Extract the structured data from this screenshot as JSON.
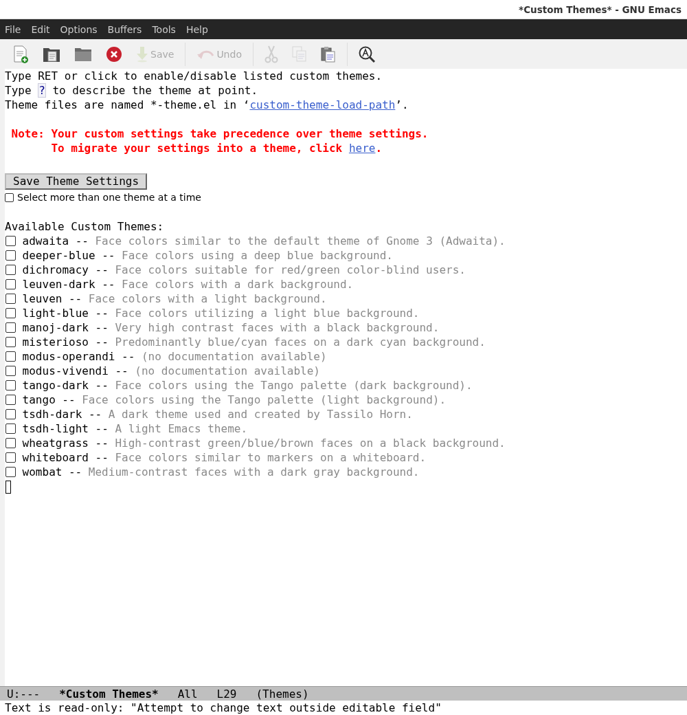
{
  "window": {
    "title": "*Custom Themes* - GNU Emacs"
  },
  "menu_bar": [
    "File",
    "Edit",
    "Options",
    "Buffers",
    "Tools",
    "Help"
  ],
  "toolbar": [
    {
      "kind": "new-file",
      "disabled": false
    },
    {
      "kind": "open-file",
      "disabled": false
    },
    {
      "kind": "open-dir",
      "disabled": false
    },
    {
      "kind": "close",
      "disabled": false
    },
    {
      "kind": "save",
      "label": "Save",
      "disabled": true
    },
    {
      "kind": "separator"
    },
    {
      "kind": "undo",
      "label": "Undo",
      "disabled": true
    },
    {
      "kind": "separator"
    },
    {
      "kind": "cut",
      "disabled": true
    },
    {
      "kind": "copy",
      "disabled": true
    },
    {
      "kind": "paste",
      "disabled": false
    },
    {
      "kind": "separator"
    },
    {
      "kind": "search",
      "disabled": false
    }
  ],
  "help_lines": [
    [
      {
        "kind": "text",
        "text": "Type RET or click to enable/disable listed custom themes."
      }
    ],
    [
      {
        "kind": "text",
        "text": "Type "
      },
      {
        "kind": "key",
        "text": "?"
      },
      {
        "kind": "text",
        "text": " to describe the theme at point."
      }
    ],
    [
      {
        "kind": "text",
        "text": "Theme files are named *-theme.el in ‘"
      },
      {
        "kind": "link",
        "text": "custom-theme-load-path"
      },
      {
        "kind": "text",
        "text": "’."
      }
    ]
  ],
  "note_lines": [
    [
      {
        "kind": "text",
        "text": "Note: Your custom settings take precedence over theme settings."
      }
    ],
    [
      {
        "kind": "text",
        "text": "      To migrate your settings into a theme, click "
      },
      {
        "kind": "link",
        "text": "here"
      },
      {
        "kind": "text",
        "text": "."
      }
    ]
  ],
  "save_button": "Save Theme Settings",
  "multi_select": {
    "label": "Select more than one theme at a time",
    "checked": false
  },
  "themes_heading": "Available Custom Themes:",
  "themes": [
    {
      "name": "adwaita",
      "separator": "--",
      "description": "Face colors similar to the default theme of Gnome 3 (Adwaita).",
      "checked": false
    },
    {
      "name": "deeper-blue",
      "separator": "--",
      "description": "Face colors using a deep blue background.",
      "checked": false
    },
    {
      "name": "dichromacy",
      "separator": "--",
      "description": "Face colors suitable for red/green color-blind users.",
      "checked": false
    },
    {
      "name": "leuven-dark",
      "separator": "--",
      "description": "Face colors with a dark background.",
      "checked": false
    },
    {
      "name": "leuven",
      "separator": "--",
      "description": "Face colors with a light background.",
      "checked": false
    },
    {
      "name": "light-blue",
      "separator": "--",
      "description": "Face colors utilizing a light blue background.",
      "checked": false
    },
    {
      "name": "manoj-dark",
      "separator": "--",
      "description": "Very high contrast faces with a black background.",
      "checked": false
    },
    {
      "name": "misterioso",
      "separator": "--",
      "description": "Predominantly blue/cyan faces on a dark cyan background.",
      "checked": false
    },
    {
      "name": "modus-operandi",
      "separator": "--",
      "description": "(no documentation available)",
      "checked": false
    },
    {
      "name": "modus-vivendi",
      "separator": "--",
      "description": "(no documentation available)",
      "checked": false
    },
    {
      "name": "tango-dark",
      "separator": "--",
      "description": "Face colors using the Tango palette (dark background).",
      "checked": false
    },
    {
      "name": "tango",
      "separator": "--",
      "description": "Face colors using the Tango palette (light background).",
      "checked": false
    },
    {
      "name": "tsdh-dark",
      "separator": "--",
      "description": "A dark theme used and created by Tassilo Horn.",
      "checked": false
    },
    {
      "name": "tsdh-light",
      "separator": "--",
      "description": "A light Emacs theme.",
      "checked": false
    },
    {
      "name": "wheatgrass",
      "separator": "--",
      "description": "High-contrast green/blue/brown faces on a black background.",
      "checked": false
    },
    {
      "name": "whiteboard",
      "separator": "--",
      "description": "Face colors similar to markers on a whiteboard.",
      "checked": false
    },
    {
      "name": "wombat",
      "separator": "--",
      "description": "Medium-contrast faces with a dark gray background.",
      "checked": false
    }
  ],
  "mode_line": {
    "status": "U:---",
    "buffer": "*Custom Themes*",
    "position": "All",
    "line": "L29",
    "mode": "(Themes)"
  },
  "echo_area": "Text is read-only: \"Attempt to change text outside editable field\""
}
